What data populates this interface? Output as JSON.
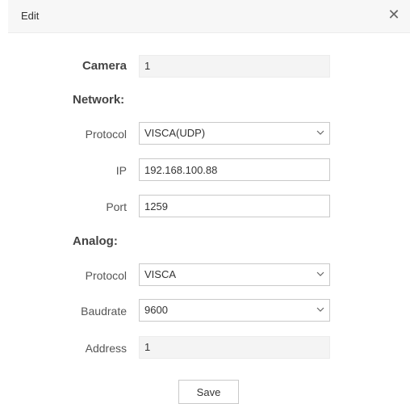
{
  "dialog": {
    "title": "Edit",
    "close_glyph": "✕",
    "close_icon": "close-icon"
  },
  "camera": {
    "label": "Camera",
    "value": "1"
  },
  "network": {
    "heading": "Network:",
    "protocol_label": "Protocol",
    "protocol_value": "VISCA(UDP)",
    "ip_label": "IP",
    "ip_value": "192.168.100.88",
    "port_label": "Port",
    "port_value": "1259"
  },
  "analog": {
    "heading": "Analog:",
    "protocol_label": "Protocol",
    "protocol_value": "VISCA",
    "baudrate_label": "Baudrate",
    "baudrate_value": "9600",
    "address_label": "Address",
    "address_value": "1"
  },
  "actions": {
    "save_label": "Save"
  },
  "colors": {
    "header_bg": "#f7f7f7",
    "border": "#c9c9c9",
    "readonly_bg": "#f4f4f4",
    "text": "#333333"
  }
}
